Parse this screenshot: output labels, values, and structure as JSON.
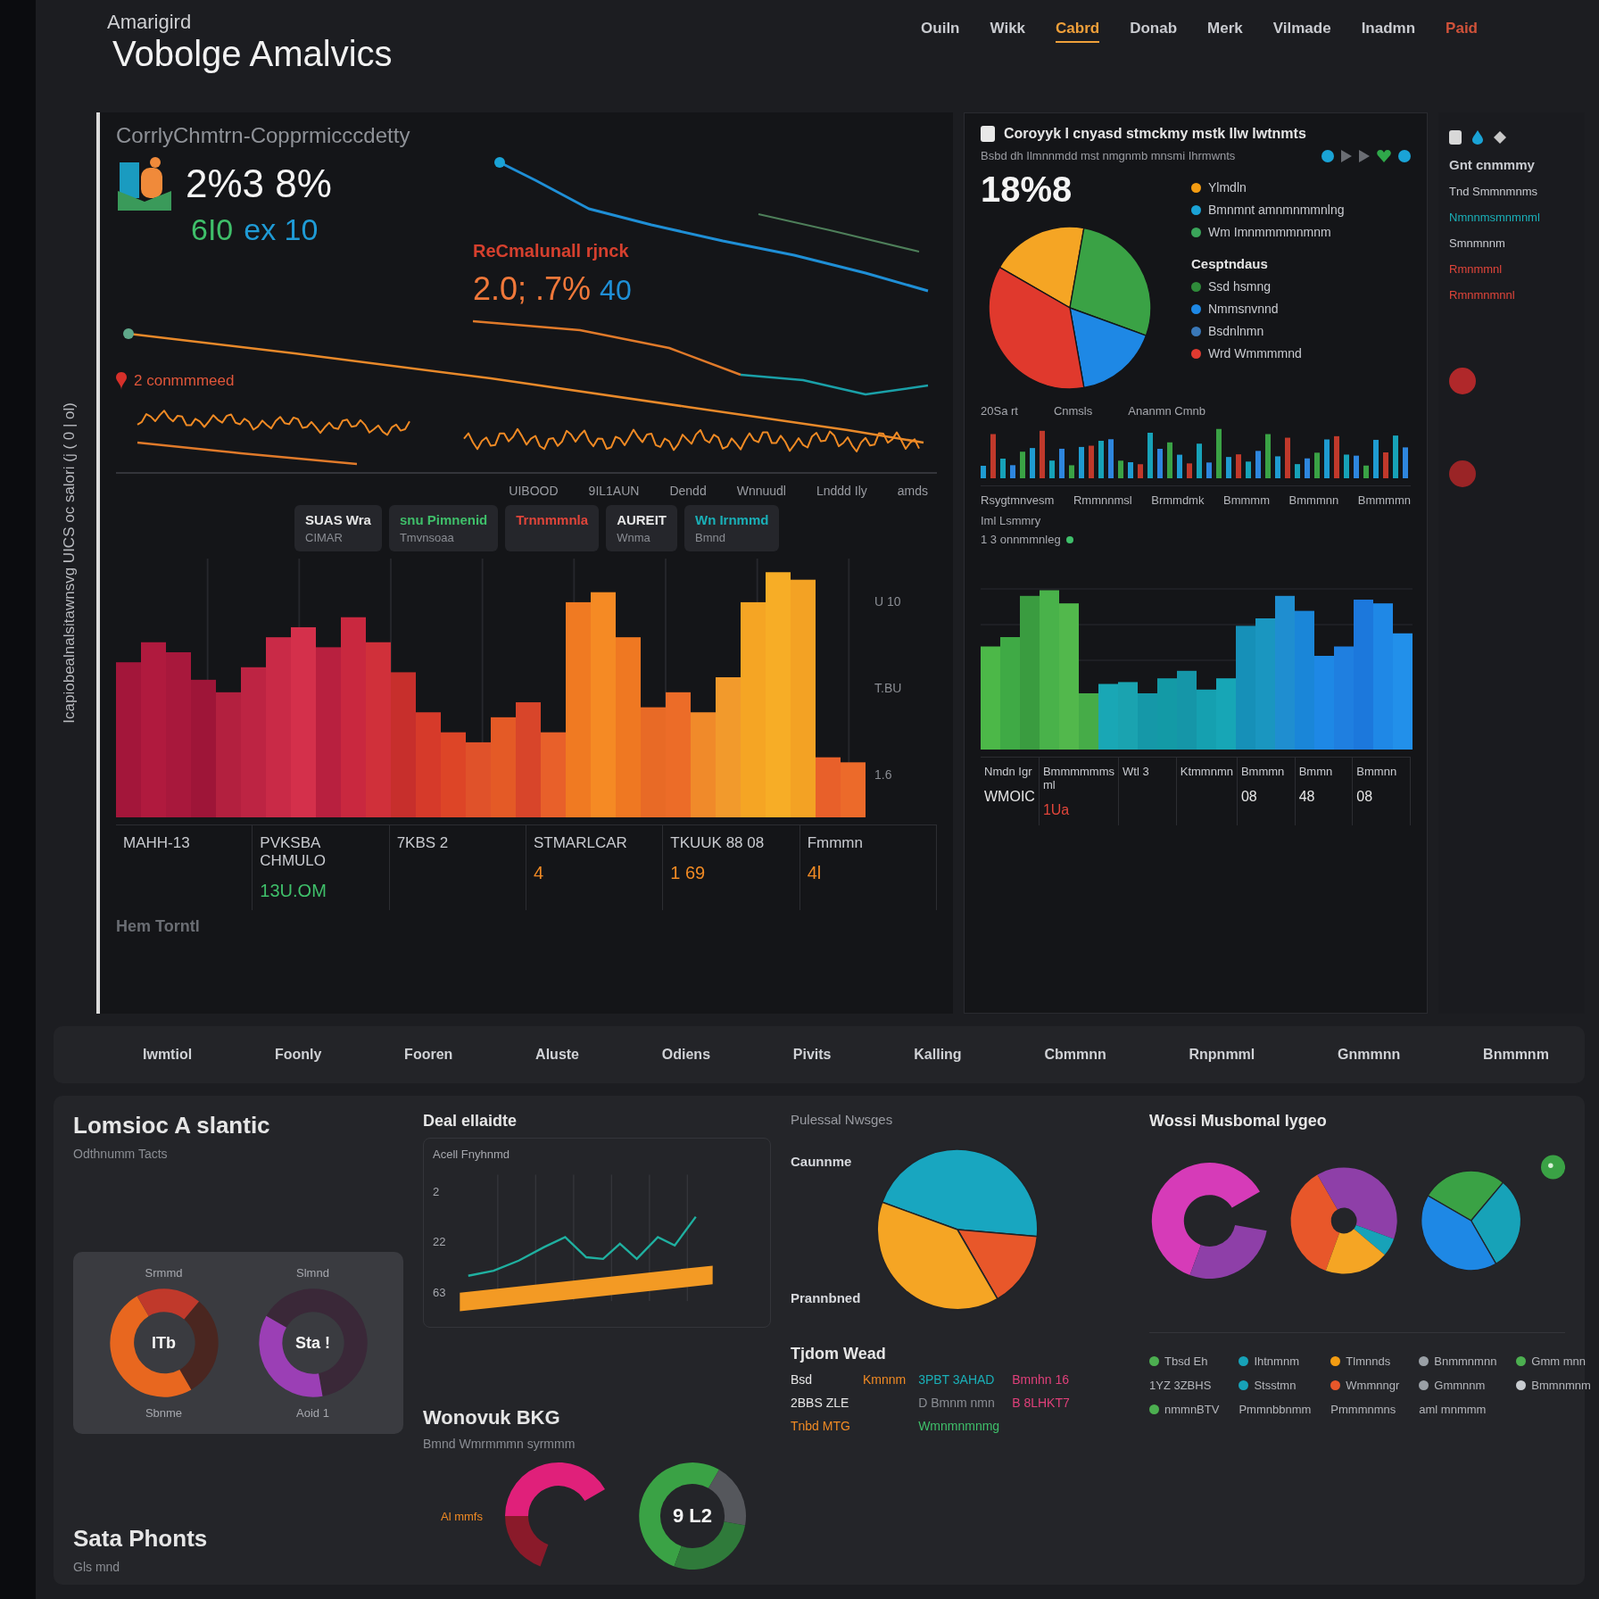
{
  "header": {
    "overline": "Amarigird",
    "title": "Vobolge Amalvics",
    "nav": [
      {
        "label": "Ouiln",
        "selected": false,
        "alert": false
      },
      {
        "label": "Wikk",
        "selected": false,
        "alert": false
      },
      {
        "label": "Cabrd",
        "selected": true,
        "alert": false
      },
      {
        "label": "Donab",
        "selected": false,
        "alert": false
      },
      {
        "label": "Merk",
        "selected": false,
        "alert": false
      },
      {
        "label": "Vilmade",
        "selected": false,
        "alert": false
      },
      {
        "label": "Inadmn",
        "selected": false,
        "alert": false
      },
      {
        "label": "Paid",
        "selected": false,
        "alert": true
      }
    ]
  },
  "side_label": "Icapiobealnalsitawnsvg UICS oc salori (j ( 0 | ol)",
  "trend_panel": {
    "title": "CorrlyChmtrn-Copprmicccdetty",
    "kpi_value": "2%3 8%",
    "kpi_secondary": "6I0",
    "kpi_tertiary": "ex 10",
    "alert_label": "ReCmalunall rjnck",
    "alert_value": "2.0; .7%",
    "alert_value_b": "40",
    "series_label": "2 conmmmeed",
    "axis_labels": [
      "UIBOOD",
      "9IL1AUN",
      "Dendd",
      "Wnnuudl",
      "Lnddd Ily",
      "amds"
    ],
    "chips": [
      {
        "title": "SUAS Wra",
        "sub": "CIMAR",
        "color": "#e6e6e6"
      },
      {
        "title": "snu Pimnenid",
        "sub": "Tmvnsoaa",
        "color": "#3fbf6a"
      },
      {
        "title": "Trnnmmnla",
        "color": "#e0453a"
      },
      {
        "title": "AUREIT",
        "sub": "Wnma",
        "color": "#e6e6e6"
      },
      {
        "title": "Wn Irnmmd",
        "sub": "Bmnd",
        "color": "#1ab0b8"
      }
    ],
    "yticks": [
      "U 10",
      "T.BU",
      "1.6"
    ],
    "columns": [
      {
        "label": "MAHH-13"
      },
      {
        "label": "PVKSBA CHMULO",
        "value": "13U.OM",
        "color": "#3fbf6a"
      },
      {
        "label": "7KBS 2"
      },
      {
        "label": "STMARLCAR",
        "value": "4",
        "color": "#f08a24"
      },
      {
        "label": "TKUUK 88 08",
        "value": "1 69",
        "color": "#f08a24"
      },
      {
        "label": "Fmmmn",
        "value": "4l",
        "color": "#f08a24"
      }
    ],
    "footer": "Hem Torntl"
  },
  "summary_panel": {
    "title": "Coroyyk I cnyasd stmckmy mstk Ilw lwtnmts",
    "subtitle": "Bsbd dh Ilmnnmdd mst nmgnmb mnsmi Ihrmwnts",
    "value": "18%8",
    "notes": [
      {
        "label": "Ylmdln",
        "color": "#f39c12"
      },
      {
        "label": "Bmnmnt amnmnmmnlng",
        "color": "#1ba3d6"
      },
      {
        "label": "Wm Imnmmmmnmnm",
        "color": "#3aa55a"
      }
    ],
    "legend_title": "Cesptndaus",
    "legend": [
      {
        "label": "Ssd hsmng",
        "color": "#2f8a3a"
      },
      {
        "label": "Nmmsnvnnd",
        "color": "#1e88e5"
      },
      {
        "label": "Bsdnlnmn",
        "color": "#3a78b8"
      },
      {
        "label": "Wrd Wmmmmnd",
        "color": "#e03a30"
      }
    ],
    "strip_labels": [
      "20Sa rt",
      "Cnmsls",
      "Ananmn Cmnb"
    ],
    "header_row": [
      "Rsygtmnvesm",
      "Rmmnnmsl",
      "Brmmdmk",
      "Bmmmm",
      "Bmmmnn",
      "Bmmmmn"
    ],
    "chart_label": "Iml Lsmmry",
    "chart_sublabel": "1 3 onnmmnleg",
    "columns": [
      {
        "label": "Nmdn Igr",
        "value": "WMOIC",
        "color": "#e6e6e6"
      },
      {
        "label": "Bmmmmmms ml",
        "value": "1Ua",
        "color": "#e0453a"
      },
      {
        "label": "Wtl 3"
      },
      {
        "label": "Ktmmnmn"
      },
      {
        "label": "Bmmmn",
        "value": "08",
        "color": "#e6e6e6"
      },
      {
        "label": "Bmmn",
        "value": "48",
        "color": "#e6e6e6"
      },
      {
        "label": "Bmmnn",
        "value": "08",
        "color": "#e6e6e6"
      }
    ]
  },
  "side_column": {
    "title": "Gnt cnmmmy",
    "items": [
      {
        "label": "Tnd Smmnmnms",
        "color": "#c9cbd0"
      },
      {
        "label": "Nmnnmsmnmnml",
        "color": "#1ab0b8"
      },
      {
        "label": "Smnmnnm",
        "color": "#c9cbd0"
      },
      {
        "label": "Rmnmmnl",
        "color": "#e0453a"
      },
      {
        "label": "Rmnmnmnnl",
        "color": "#e0453a"
      }
    ]
  },
  "tabs": [
    "Iwmtiol",
    "Foonly",
    "Fooren",
    "Aluste",
    "Odiens",
    "Pivits",
    "Kalling",
    "Cbmmnn",
    "Rnpnmml",
    "Gnmmnn",
    "Bnmmnm"
  ],
  "bottom": {
    "profile": {
      "title": "Lomsioc A slantic",
      "subtitle": "Odthnumm Tacts",
      "gauges": [
        {
          "top": "Srmmd",
          "center": "ITb",
          "bottom": "Sbnme",
          "kind": "warm"
        },
        {
          "top": "Slmnd",
          "center": "Sta !",
          "bottom": "Aoid 1",
          "kind": "violet"
        }
      ],
      "footer_title": "Sata Phonts",
      "footer_sub": "Gls mnd"
    },
    "trend": {
      "title": "Deal ellaidte",
      "chart_label": "Acell Fnyhnmd",
      "yticks": [
        "2",
        "22",
        "63"
      ],
      "title2": "Wonovuk BKG",
      "subtitle2": "Bmnd Wmrmmmn syrmmm",
      "donut_label": "Al mmfs",
      "donut_value": "9 L2"
    },
    "mix": {
      "title": "Pulessal Nwsges",
      "label_top": "Caunnme",
      "label_bottom": "Prannbned",
      "list_title": "Tjdom Wead",
      "rows": [
        [
          {
            "text": "Bsd",
            "color": "#e6e6e6"
          },
          {
            "text": "Kmnnm",
            "color": "#f08a24"
          },
          {
            "text": "3PBT 3AHAD",
            "color": "#1ab0b8"
          },
          {
            "text": "Bmnhn 16",
            "color": "#e0407a"
          }
        ],
        [
          {
            "text": "2BBS ZLE",
            "color": "#e6e6e6"
          },
          {
            "text": ""
          },
          {
            "text": "D Bmnm nmn",
            "color": "#8a8d93"
          },
          {
            "text": "B 8LHKT7",
            "color": "#e0407a"
          }
        ],
        [
          {
            "text": "Tnbd MTG",
            "color": "#f08a24"
          },
          {
            "text": ""
          },
          {
            "text": "Wmnmnmnmg",
            "color": "#3fbf6a"
          },
          {
            "text": ""
          }
        ]
      ]
    },
    "segments": {
      "title": "Wossi Musbomal Iygeo",
      "legend": [
        [
          {
            "label": "Tbsd Eh",
            "color": "#4caf50"
          },
          {
            "label": "1YZ 3ZBHS"
          },
          {
            "label": "nmmnBTV",
            "color": "#4caf50"
          }
        ],
        [
          {
            "label": "Ihtnmnm",
            "color": "#17a2b8"
          },
          {
            "label": "Stsstmn",
            "color": "#17a2b8"
          },
          {
            "label": "Pmmnbbnmm"
          }
        ],
        [
          {
            "label": "Tlmnnds",
            "color": "#f39c12"
          },
          {
            "label": "Wmmnngr",
            "color": "#e8572a"
          },
          {
            "label": "Pmmmnmns"
          }
        ],
        [
          {
            "label": "Bnmmnmnn",
            "color": "#9aa0a6"
          },
          {
            "label": "Gmmnnm",
            "color": "#9aa0a6"
          },
          {
            "label": "aml mnmmm"
          }
        ],
        [
          {
            "label": "Gmm mnn",
            "color": "#4caf50"
          },
          {
            "label": "Bmmnmnm",
            "color": "#c8ccd0"
          }
        ]
      ]
    }
  }
}
